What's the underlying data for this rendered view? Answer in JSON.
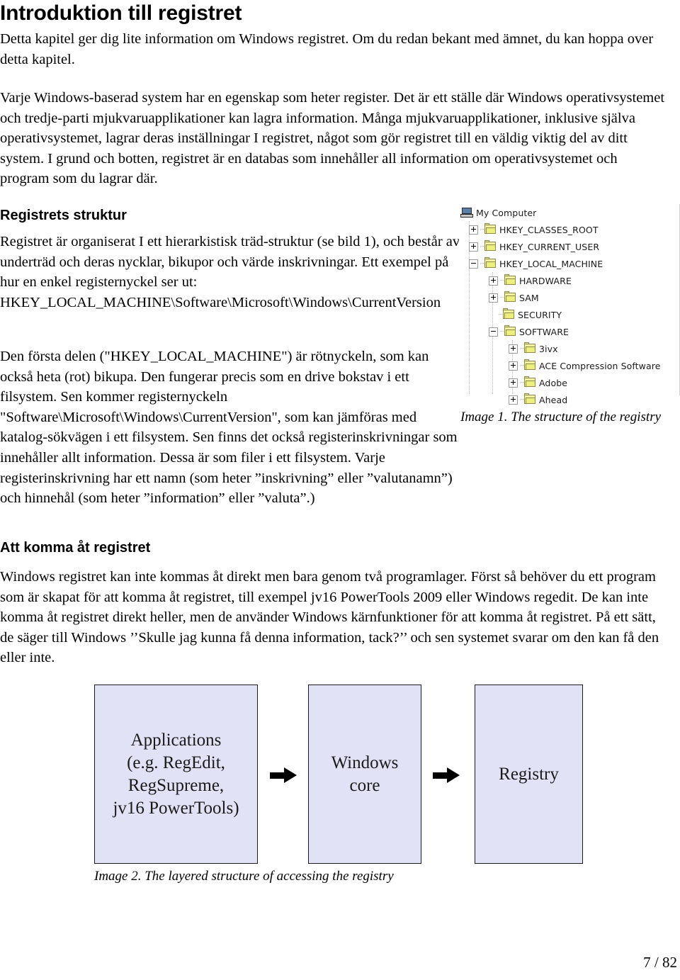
{
  "page": {
    "title": "Introduktion till registret",
    "page_number": "7 / 82"
  },
  "paragraphs": {
    "intro": "Detta kapitel ger dig lite information om Windows registret. Om du redan bekant med ämnet, du kan hoppa over detta kapitel.",
    "varje": "Varje Windows-baserad system har en egenskap som heter register. Det är ett ställe där Windows operativsystemet och tredje-parti mjukvaruapplikationer kan lagra information. Många mjukvaruapplikationer, inklusive själva operativsystemet, lagrar deras inställningar I registret, något som gör registret till en väldig viktig del av ditt system. I grund och botten, registret är en databas som innehåller all information om operativsystemet och program som du lagrar där.",
    "struktur_1": "Registret är organiserat I ett hierarkistisk träd-struktur (se bild 1), och består av underträd och deras nycklar, bikupor och värde inskrivningar. Ett exempel på hur en enkel registernyckel ser ut: HKEY_LOCAL_MACHINE\\Software\\Microsoft\\Windows\\CurrentVersion",
    "struktur_2": "Den första delen (\"HKEY_LOCAL_MACHINE\") är rötnyckeln, som kan också heta (rot) bikupa. Den fungerar precis som en drive bokstav i ett filsystem. Sen kommer registernyckeln \"Software\\Microsoft\\Windows\\CurrentVersion\", som kan jämföras med katalog-sökvägen i ett filsystem. Sen finns det också registerinskrivningar som innehåller allt information. Dessa är som filer i ett filsystem. Varje registerinskrivning har ett namn (som heter ”inskrivning” eller ”valutanamn”) och hinnehål (som heter ”information” eller ”valuta”.)",
    "access": "Windows registret kan inte kommas åt direkt men bara genom två programlager. Först så behöver du ett program som är skapat för att komma åt registret, till exempel jv16 PowerTools 2009 eller Windows regedit. De kan inte komma åt registret direkt heller, men de använder Windows kärnfunktioner för att komma åt registret. På ett sätt, de säger till Windows ’’Skulle jag kunna få denna information, tack?’’ och sen systemet svarar om den kan få den eller inte."
  },
  "headings": {
    "registrets_struktur": "Registrets struktur",
    "att_komma_at_registret": "Att komma åt registret"
  },
  "registry_tree": {
    "caption": "Image 1. The structure of the registry",
    "nodes": [
      {
        "label": "My Computer",
        "icon": "computer-icon",
        "level": 1,
        "expander": "none"
      },
      {
        "label": "HKEY_CLASSES_ROOT",
        "icon": "folder-icon",
        "level": 2,
        "expander": "plus"
      },
      {
        "label": "HKEY_CURRENT_USER",
        "icon": "folder-icon",
        "level": 2,
        "expander": "plus"
      },
      {
        "label": "HKEY_LOCAL_MACHINE",
        "icon": "folder-icon",
        "level": 2,
        "expander": "minus"
      },
      {
        "label": "HARDWARE",
        "icon": "folder-icon",
        "level": 3,
        "expander": "plus"
      },
      {
        "label": "SAM",
        "icon": "folder-icon",
        "level": 3,
        "expander": "plus"
      },
      {
        "label": "SECURITY",
        "icon": "folder-icon",
        "level": 3,
        "expander": "none"
      },
      {
        "label": "SOFTWARE",
        "icon": "folder-icon",
        "level": 3,
        "expander": "minus"
      },
      {
        "label": "3ivx",
        "icon": "folder-icon",
        "level": 4,
        "expander": "plus"
      },
      {
        "label": "ACE Compression Software",
        "icon": "folder-icon",
        "level": 4,
        "expander": "plus"
      },
      {
        "label": "Adobe",
        "icon": "folder-icon",
        "level": 4,
        "expander": "plus"
      },
      {
        "label": "Ahead",
        "icon": "folder-icon",
        "level": 4,
        "expander": "plus"
      }
    ]
  },
  "layer_diagram": {
    "caption": "Image 2. The layered structure of accessing the registry",
    "box_fill": "#e2e2f7",
    "boxes": [
      {
        "label": "Applications\n(e.g. RegEdit,\nRegSupreme,\njv16 PowerTools)"
      },
      {
        "label": "Windows\ncore"
      },
      {
        "label": "Registry"
      }
    ]
  }
}
